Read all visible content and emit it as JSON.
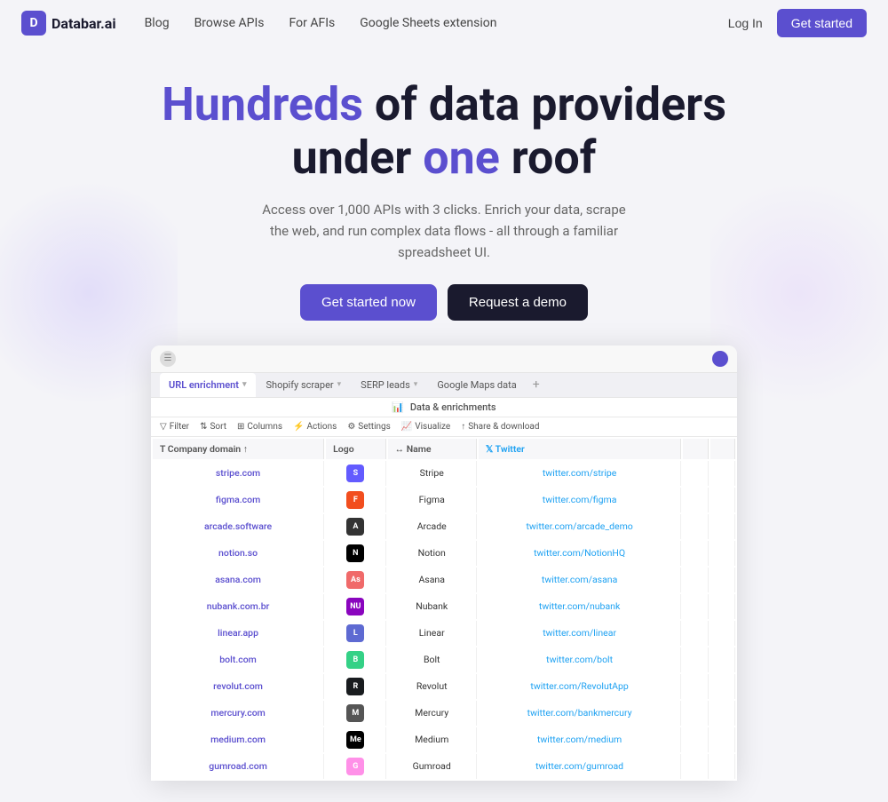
{
  "navbar": {
    "logo_text": "Databar.ai",
    "links": [
      {
        "label": "Blog",
        "id": "blog"
      },
      {
        "label": "Browse APIs",
        "id": "browse-apis"
      },
      {
        "label": "For AFIs",
        "id": "for-afis"
      },
      {
        "label": "Google Sheets extension",
        "id": "sheets-ext"
      }
    ],
    "login_label": "Log In",
    "get_started_label": "Get started"
  },
  "hero": {
    "heading_part1": "Hundreds",
    "heading_part2": " of data providers",
    "heading_part3": "under ",
    "heading_one": "one",
    "heading_part4": " roof",
    "subtext": "Access over 1,000 APIs with 3 clicks. Enrich your data, scrape the web, and run complex data flows - all through a familiar spreadsheet UI.",
    "btn_primary": "Get started now",
    "btn_secondary": "Request a demo"
  },
  "dashboard": {
    "sheet_label": "Data & enrichments",
    "tabs": [
      {
        "label": "URL enrichment",
        "active": true
      },
      {
        "label": "Shopify scraper",
        "active": false
      },
      {
        "label": "SERP leads",
        "active": false
      },
      {
        "label": "Google Maps data",
        "active": false
      }
    ],
    "toolbar_items": [
      {
        "label": "Filter"
      },
      {
        "label": "Sort"
      },
      {
        "label": "Columns"
      },
      {
        "label": "Actions"
      },
      {
        "label": "Settings"
      },
      {
        "label": "Visualize"
      },
      {
        "label": "Share & download"
      }
    ],
    "columns": [
      "Company domain ↑",
      "Logo",
      "Name",
      "Twitter"
    ],
    "rows": [
      {
        "company": "stripe.com",
        "logo_bg": "#635BFF",
        "logo_text": "S",
        "name": "Stripe",
        "twitter": "twitter.com/stripe"
      },
      {
        "company": "figma.com",
        "logo_bg": "#F24E1E",
        "logo_text": "F",
        "name": "Figma",
        "twitter": "twitter.com/figma"
      },
      {
        "company": "arcade.software",
        "logo_bg": "#333",
        "logo_text": "A",
        "name": "Arcade",
        "twitter": "twitter.com/arcade_demo"
      },
      {
        "company": "notion.so",
        "logo_bg": "#000",
        "logo_text": "N",
        "name": "Notion",
        "twitter": "twitter.com/NotionHQ"
      },
      {
        "company": "asana.com",
        "logo_bg": "#F06A6A",
        "logo_text": "As",
        "name": "Asana",
        "twitter": "twitter.com/asana"
      },
      {
        "company": "nubank.com.br",
        "logo_bg": "#8A05BE",
        "logo_text": "NU",
        "name": "Nubank",
        "twitter": "twitter.com/nubank"
      },
      {
        "company": "linear.app",
        "logo_bg": "#5E6AD2",
        "logo_text": "L",
        "name": "Linear",
        "twitter": "twitter.com/linear"
      },
      {
        "company": "bolt.com",
        "logo_bg": "#34D186",
        "logo_text": "B",
        "name": "Bolt",
        "twitter": "twitter.com/bolt"
      },
      {
        "company": "revolut.com",
        "logo_bg": "#191C1F",
        "logo_text": "R",
        "name": "Revolut",
        "twitter": "twitter.com/RevolutApp"
      },
      {
        "company": "mercury.com",
        "logo_bg": "#555",
        "logo_text": "M",
        "name": "Mercury",
        "twitter": "twitter.com/bankmercury"
      },
      {
        "company": "medium.com",
        "logo_bg": "#000",
        "logo_text": "Me",
        "name": "Medium",
        "twitter": "twitter.com/medium"
      },
      {
        "company": "gumroad.com",
        "logo_bg": "#FF90E8",
        "logo_text": "G",
        "name": "Gumroad",
        "twitter": "twitter.com/gumroad"
      }
    ]
  }
}
